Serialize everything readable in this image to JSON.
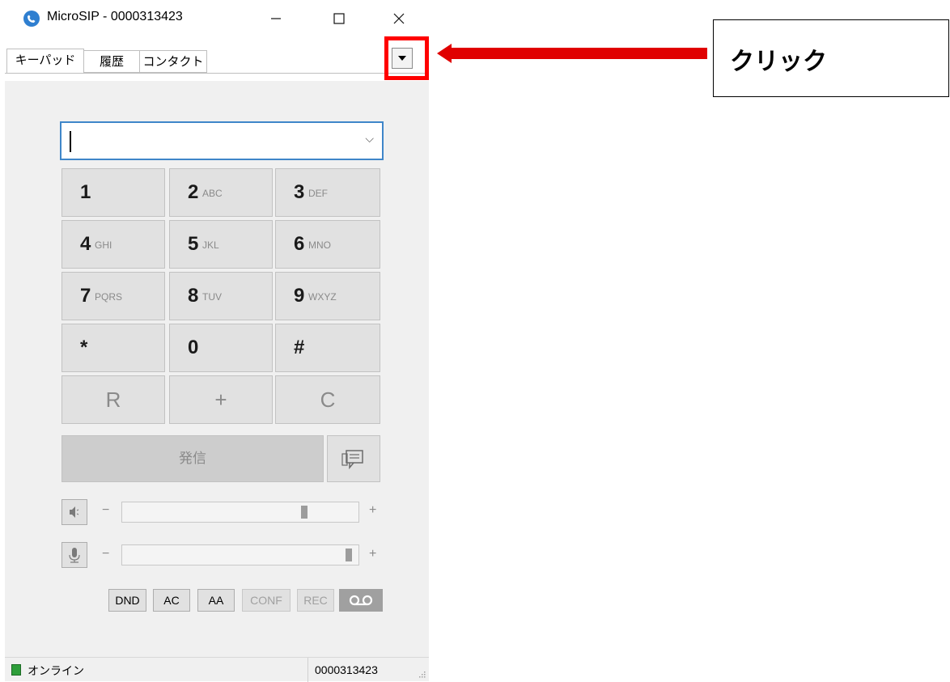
{
  "window": {
    "title": "MicroSIP - 0000313423",
    "controls": {
      "minimize": "—",
      "maximize": "☐",
      "close": "✕"
    }
  },
  "tabs": [
    {
      "label": "キーパッド",
      "active": true
    },
    {
      "label": "履歴",
      "active": false
    },
    {
      "label": "コンタクト",
      "active": false
    }
  ],
  "dial_input": {
    "value": "",
    "chevron": "⌵"
  },
  "keypad": [
    {
      "digit": "1",
      "letters": ""
    },
    {
      "digit": "2",
      "letters": "ABC"
    },
    {
      "digit": "3",
      "letters": "DEF"
    },
    {
      "digit": "4",
      "letters": "GHI"
    },
    {
      "digit": "5",
      "letters": "JKL"
    },
    {
      "digit": "6",
      "letters": "MNO"
    },
    {
      "digit": "7",
      "letters": "PQRS"
    },
    {
      "digit": "8",
      "letters": "TUV"
    },
    {
      "digit": "9",
      "letters": "WXYZ"
    },
    {
      "digit": "*",
      "letters": ""
    },
    {
      "digit": "0",
      "letters": ""
    },
    {
      "digit": "#",
      "letters": ""
    }
  ],
  "special_keys": {
    "redial": "R",
    "plus": "+",
    "clear": "C"
  },
  "call_button": {
    "label": "発信"
  },
  "speaker": {
    "minus": "−",
    "plus": "+",
    "level": 0.78
  },
  "microphone": {
    "minus": "−",
    "plus": "+",
    "level": 0.98
  },
  "options": {
    "dnd": "DND",
    "ac": "AC",
    "aa": "AA",
    "conf": "CONF",
    "rec": "REC"
  },
  "status": {
    "text": "オンライン",
    "number": "0000313423"
  },
  "annotation": {
    "callout_text": "クリック",
    "arrow_color": "#e00000",
    "highlight_color": "#ff0000"
  },
  "colors": {
    "input_border": "#3f86c9",
    "online": "#2e9e3a"
  }
}
